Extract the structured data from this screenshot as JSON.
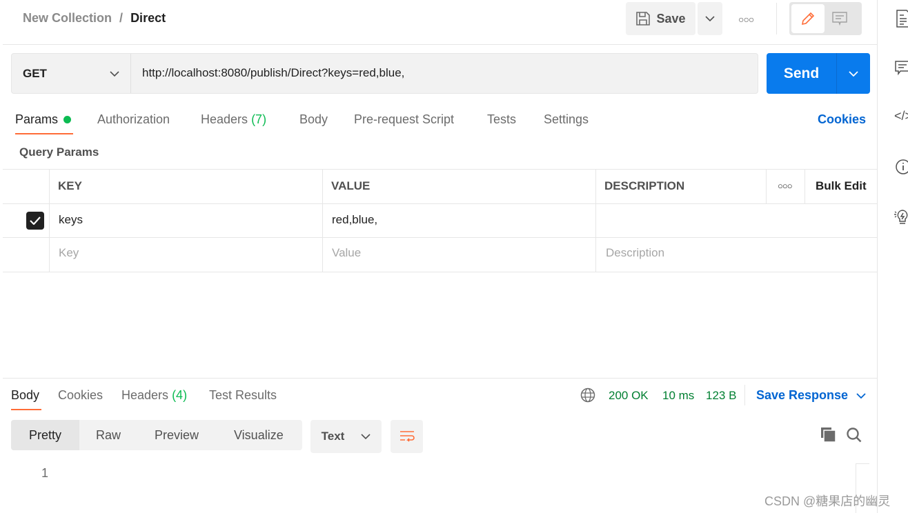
{
  "breadcrumb": {
    "collection": "New Collection",
    "separator": "/",
    "request": "Direct"
  },
  "header": {
    "save_label": "Save"
  },
  "request": {
    "method": "GET",
    "url": "http://localhost:8080/publish/Direct?keys=red,blue,",
    "send_label": "Send"
  },
  "tabs": {
    "params": "Params",
    "authorization": "Authorization",
    "headers": "Headers",
    "headers_count": "(7)",
    "body": "Body",
    "prerequest": "Pre-request Script",
    "tests": "Tests",
    "settings": "Settings",
    "cookies": "Cookies"
  },
  "query_params": {
    "title": "Query Params",
    "columns": {
      "key": "KEY",
      "value": "VALUE",
      "description": "DESCRIPTION",
      "bulk_edit": "Bulk Edit"
    },
    "rows": [
      {
        "checked": true,
        "key": "keys",
        "value": "red,blue,",
        "description": ""
      }
    ],
    "placeholders": {
      "key": "Key",
      "value": "Value",
      "description": "Description"
    }
  },
  "response": {
    "tabs": {
      "body": "Body",
      "cookies": "Cookies",
      "headers": "Headers",
      "headers_count": "(4)",
      "test_results": "Test Results"
    },
    "status": "200 OK",
    "time": "10 ms",
    "size": "123 B",
    "save_response": "Save Response",
    "views": [
      "Pretty",
      "Raw",
      "Preview",
      "Visualize"
    ],
    "format": "Text",
    "line_numbers": [
      "1"
    ]
  },
  "watermark": "CSDN @糖果店的幽灵",
  "colors": {
    "accent": "#0265d2",
    "send": "#097bed",
    "active_tab": "#ff6c37",
    "status_green": "#007f31"
  }
}
